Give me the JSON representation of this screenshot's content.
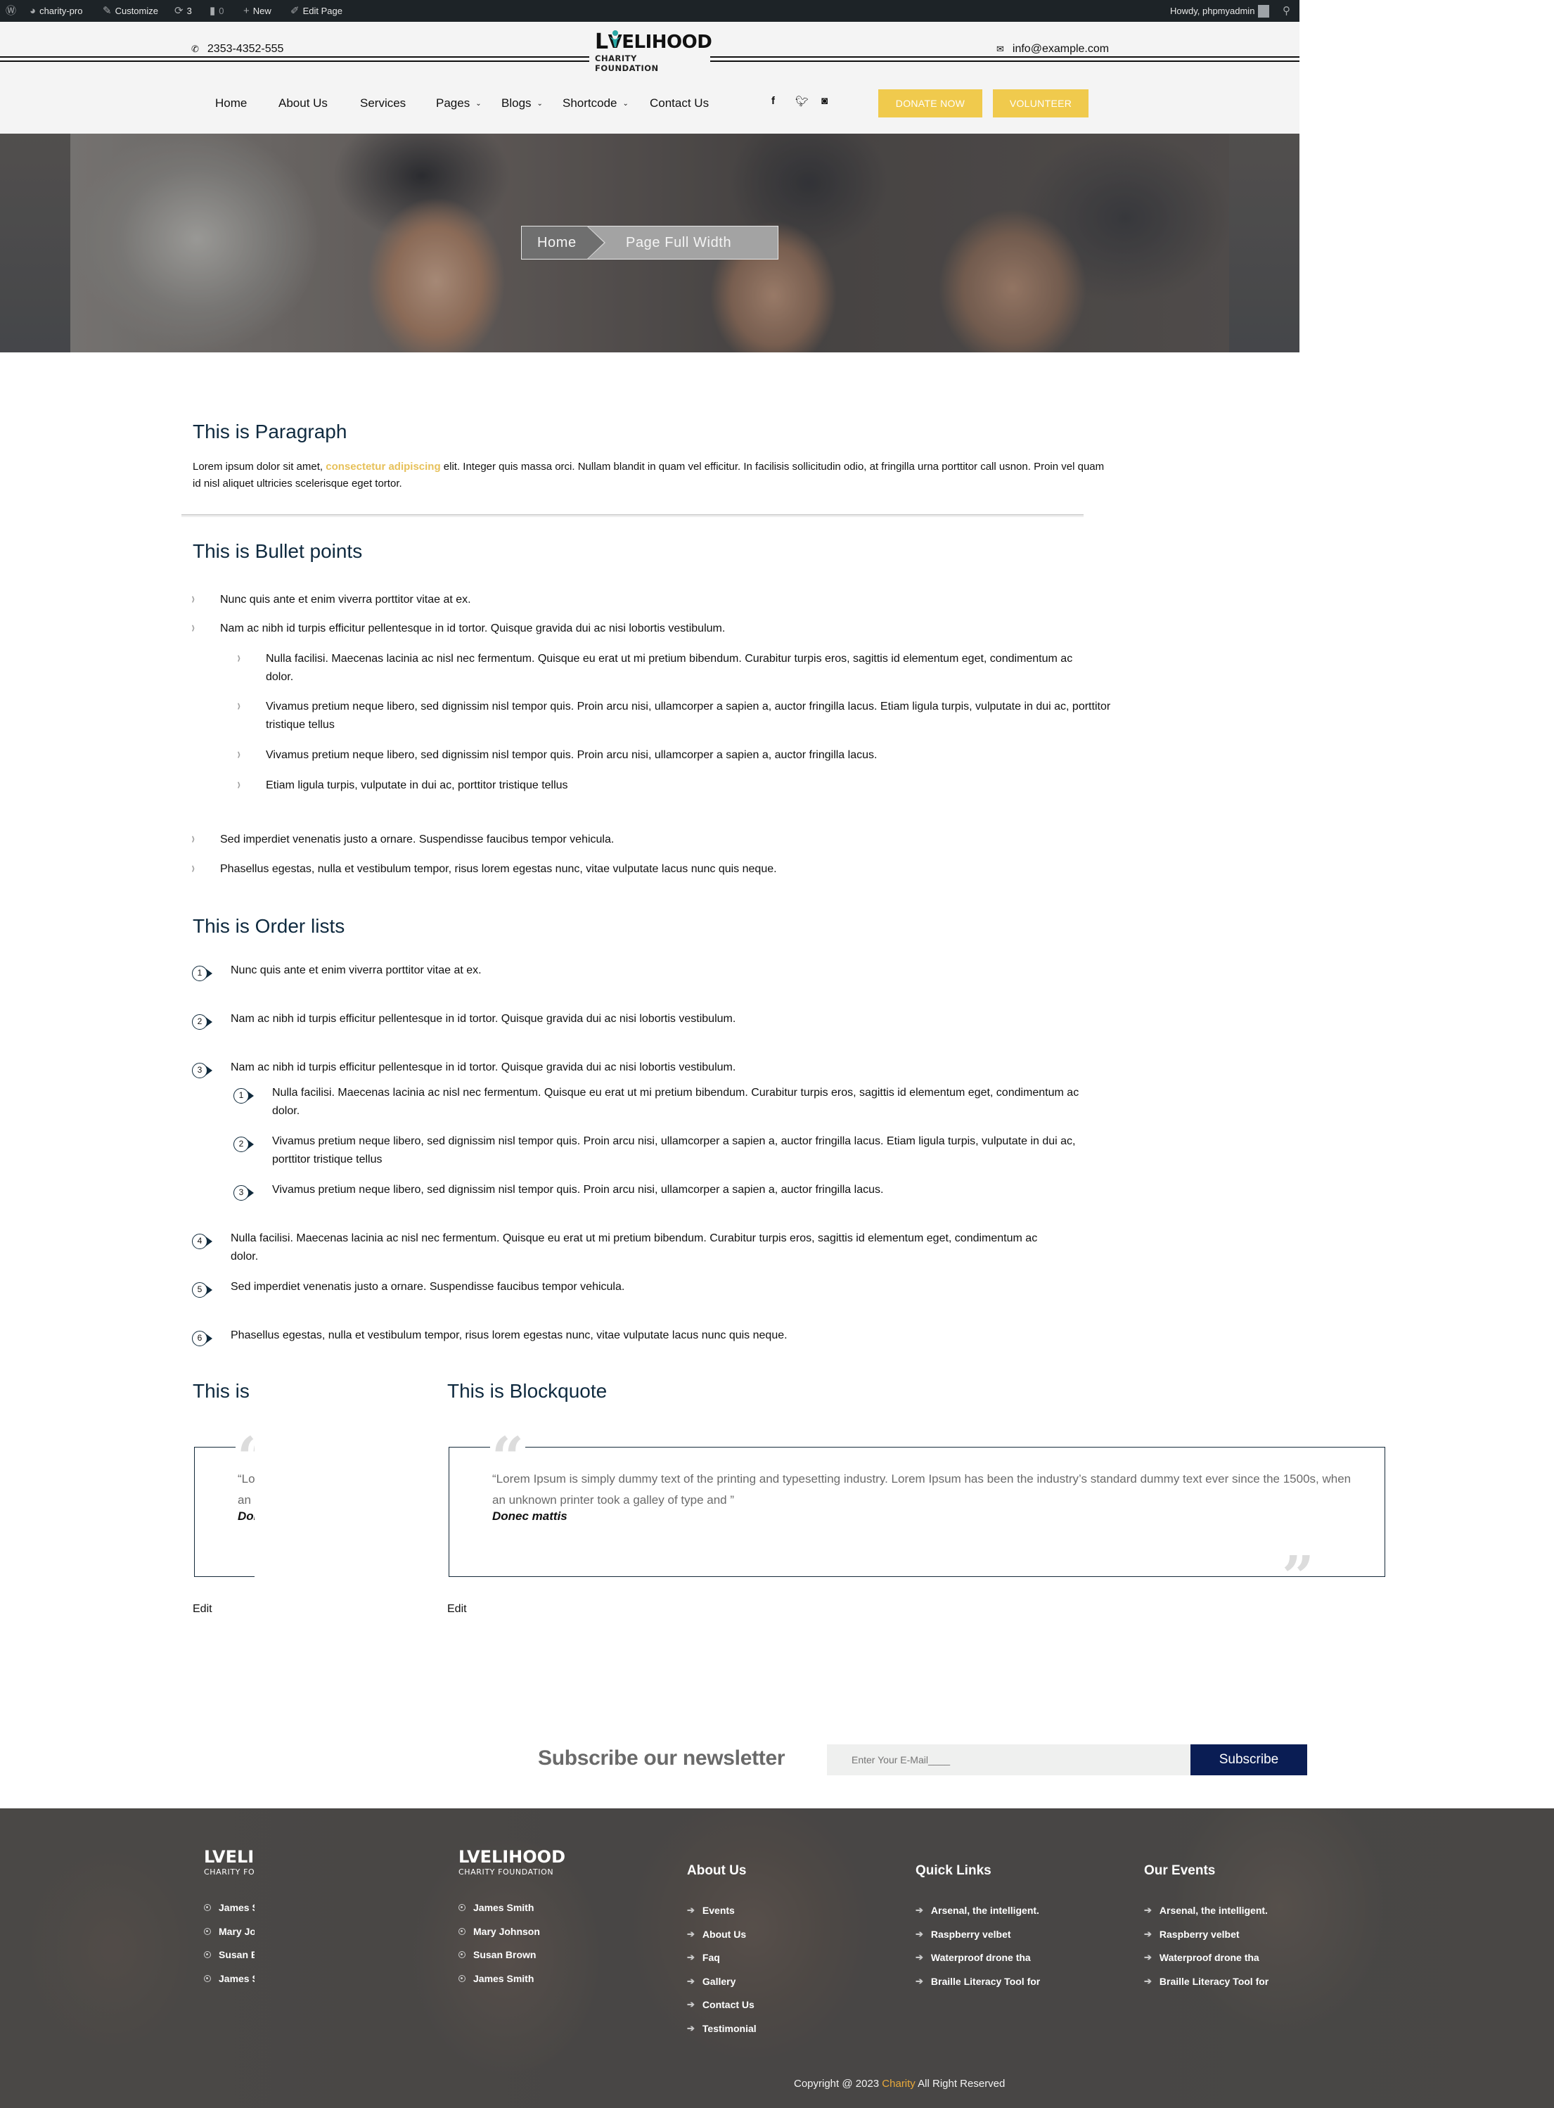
{
  "admin_bar": {
    "site_name": "charity-pro",
    "customize": "Customize",
    "updates_count": "3",
    "comments_count": "0",
    "new_label": "New",
    "edit_page": "Edit Page",
    "howdy": "Howdy, phpmyadmin"
  },
  "header": {
    "phone": "2353-4352-555",
    "email": "info@example.com",
    "logo": {
      "title_rest": "VELIHOOD",
      "title_first": "L",
      "subtitle": "CHARITY FOUNDATION"
    },
    "nav": [
      {
        "label": "Home",
        "dropdown": false
      },
      {
        "label": "About Us",
        "dropdown": false
      },
      {
        "label": "Services",
        "dropdown": false
      },
      {
        "label": "Pages",
        "dropdown": true
      },
      {
        "label": "Blogs",
        "dropdown": true
      },
      {
        "label": "Shortcode",
        "dropdown": true
      },
      {
        "label": "Contact Us",
        "dropdown": false
      }
    ],
    "social": [
      "facebook",
      "twitter",
      "instagram"
    ],
    "donate_label": "DONATE NOW",
    "volunteer_label": "VOLUNTEER",
    "accent_color": "#f0ca4d"
  },
  "hero": {
    "breadcrumb_home": "Home",
    "breadcrumb_current": "Page Full Width"
  },
  "paragraph_section": {
    "heading": "This is Paragraph",
    "text_before": "Lorem ipsum dolor sit amet, ",
    "highlight": "consectetur adipiscing",
    "text_after": " elit. Integer quis massa orci. Nullam blandit in quam vel efficitur. In facilisis sollicitudin odio, at fringilla urna porttitor call usnon. Proin vel quam id nisl aliquet ultricies scelerisque eget tortor."
  },
  "bullet_section": {
    "heading": "This is Bullet points",
    "items": [
      "Nunc quis ante et enim viverra porttitor vitae at ex.",
      "Nam ac nibh id turpis efficitur pellentesque in id tortor. Quisque gravida dui ac nisi lobortis vestibulum."
    ],
    "sub_items": [
      "Nulla facilisi. Maecenas lacinia ac nisl nec fermentum. Quisque eu erat ut mi pretium bibendum. Curabitur turpis eros, sagittis id elementum eget, condimentum ac dolor.",
      "Vivamus pretium neque libero, sed dignissim nisl tempor quis. Proin arcu nisi, ullamcorper a sapien a, auctor fringilla lacus. Etiam ligula turpis, vulputate in dui ac, porttitor tristique tellus",
      "Vivamus pretium neque libero, sed dignissim nisl tempor quis. Proin arcu nisi, ullamcorper a sapien a, auctor fringilla lacus.",
      "Etiam ligula turpis, vulputate in dui ac, porttitor tristique tellus"
    ],
    "items_after": [
      "Sed imperdiet venenatis justo a ornare. Suspendisse faucibus tempor vehicula.",
      "Phasellus egestas, nulla et vestibulum tempor, risus lorem egestas nunc, vitae vulputate lacus nunc quis neque."
    ]
  },
  "order_section": {
    "heading": "This is Order lists",
    "items": [
      {
        "n": "1",
        "text": "Nunc quis ante et enim viverra porttitor vitae at ex."
      },
      {
        "n": "2",
        "text": "Nam ac nibh id turpis efficitur pellentesque in id tortor. Quisque gravida dui ac nisi lobortis vestibulum."
      },
      {
        "n": "3",
        "text": "Nam ac nibh id turpis efficitur pellentesque in id tortor. Quisque gravida dui ac nisi lobortis vestibulum."
      }
    ],
    "sub_items": [
      {
        "n": "1",
        "text": "Nulla facilisi. Maecenas lacinia ac nisl nec fermentum. Quisque eu erat ut mi pretium bibendum. Curabitur turpis eros, sagittis id elementum eget, condimentum ac dolor."
      },
      {
        "n": "2",
        "text": "Vivamus pretium neque libero, sed dignissim nisl tempor quis. Proin arcu nisi, ullamcorper a sapien a, auctor fringilla lacus. Etiam ligula turpis, vulputate in dui ac, porttitor tristique tellus"
      },
      {
        "n": "3",
        "text": "Vivamus pretium neque libero, sed dignissim nisl tempor quis. Proin arcu nisi, ullamcorper a sapien a, auctor fringilla lacus."
      }
    ],
    "items_after": [
      {
        "n": "4",
        "text": "Nulla facilisi. Maecenas lacinia ac nisl nec fermentum. Quisque eu erat ut mi pretium bibendum. Curabitur turpis eros, sagittis id elementum eget, condimentum ac dolor."
      },
      {
        "n": "5",
        "text": "Sed imperdiet venenatis justo a ornare. Suspendisse faucibus tempor vehicula."
      },
      {
        "n": "6",
        "text": "Phasellus egestas, nulla et vestibulum tempor, risus lorem egestas nunc, vitae vulputate lacus nunc quis neque."
      }
    ]
  },
  "blockquote_section": {
    "heading": "This is Blockquote",
    "heading_clipped": "This is",
    "quote": "“Lorem Ipsum is simply dummy text of the printing and typesetting industry. Lorem Ipsum has been the industry’s standard dummy text ever since the 1500s, when an unknown printer took a galley of type and ”",
    "author": "Donec mattis",
    "edit_label": "Edit"
  },
  "newsletter": {
    "title": "Subscribe our newsletter",
    "placeholder": "Enter Your E-Mail____",
    "button": "Subscribe",
    "button_color": "#0a1d54"
  },
  "footer": {
    "logo": {
      "title": "LVELIHOOD",
      "subtitle": "CHARITY FOUNDATION"
    },
    "people": [
      "James Smith",
      "Mary Johnson",
      "Susan Brown",
      "James Smith"
    ],
    "about": {
      "heading": "About Us",
      "links": [
        "Events",
        "About Us",
        "Faq",
        "Gallery",
        "Contact Us",
        "Testimonial"
      ]
    },
    "quick_links": {
      "heading": "Quick Links",
      "links": [
        "Arsenal, the intelligent.",
        "Raspberry velbet",
        "Waterproof drone tha",
        "Braille Literacy Tool for"
      ]
    },
    "events": {
      "heading": "Our Events",
      "links": [
        "Arsenal, the intelligent.",
        "Raspberry velbet",
        "Waterproof drone tha",
        "Braille Literacy Tool for"
      ]
    },
    "copyright_before": "Copyright @ 2023 ",
    "copyright_brand": "Charity",
    "copyright_after": " All Right Reserved",
    "brand_color": "#e9a93a"
  }
}
